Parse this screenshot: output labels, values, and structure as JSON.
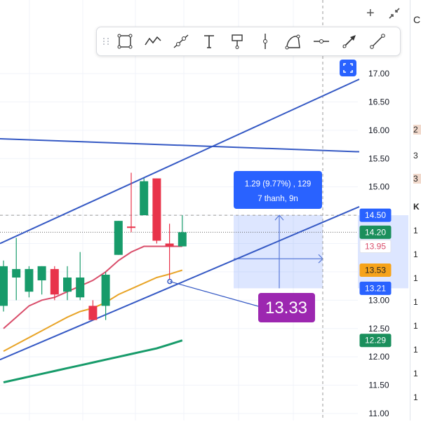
{
  "top_controls": {
    "plus_icon": "+",
    "collapse_icon": "collapse-arrows-icon"
  },
  "toolbar": {
    "tools": [
      {
        "name": "rectangle-tool-icon"
      },
      {
        "name": "path-tool-icon"
      },
      {
        "name": "ray-tool-icon"
      },
      {
        "name": "text-tool-icon",
        "glyph": "T"
      },
      {
        "name": "flag-marker-tool-icon"
      },
      {
        "name": "vertical-line-tool-icon"
      },
      {
        "name": "brush-tool-icon"
      },
      {
        "name": "horizontal-ray-tool-icon"
      },
      {
        "name": "arrow-tool-icon"
      },
      {
        "name": "trend-line-tool-icon"
      }
    ]
  },
  "chart_data": {
    "type": "candlestick",
    "y_axis": {
      "ticks": [
        "17.00",
        "16.50",
        "16.00",
        "15.50",
        "15.00",
        "14.50",
        "14.00",
        "13.50",
        "13.00",
        "12.50",
        "12.00",
        "11.50",
        "11.00"
      ],
      "ylim": [
        11.0,
        17.2
      ]
    },
    "candles": [
      {
        "o": 13.6,
        "h": 13.7,
        "l": 12.8,
        "c": 12.9,
        "color": "green"
      },
      {
        "o": 13.4,
        "h": 14.1,
        "l": 13.0,
        "c": 13.55,
        "color": "green"
      },
      {
        "o": 13.15,
        "h": 13.6,
        "l": 13.05,
        "c": 13.55,
        "color": "green"
      },
      {
        "o": 13.35,
        "h": 13.6,
        "l": 13.1,
        "c": 13.6,
        "color": "green"
      },
      {
        "o": 13.55,
        "h": 13.6,
        "l": 13.0,
        "c": 13.1,
        "color": "red"
      },
      {
        "o": 13.15,
        "h": 13.6,
        "l": 13.0,
        "c": 13.4,
        "color": "green"
      },
      {
        "o": 13.4,
        "h": 13.85,
        "l": 13.0,
        "c": 13.05,
        "color": "green"
      },
      {
        "o": 12.9,
        "h": 13.0,
        "l": 12.65,
        "c": 12.65,
        "color": "red"
      },
      {
        "o": 12.9,
        "h": 13.5,
        "l": 12.65,
        "c": 13.45,
        "color": "green"
      },
      {
        "o": 13.8,
        "h": 14.4,
        "l": 13.8,
        "c": 14.4,
        "color": "green"
      },
      {
        "o": 14.3,
        "h": 15.25,
        "l": 14.2,
        "c": 14.3,
        "color": "red"
      },
      {
        "o": 14.5,
        "h": 15.15,
        "l": 14.5,
        "c": 15.1,
        "color": "green"
      },
      {
        "o": 15.15,
        "h": 15.15,
        "l": 14.0,
        "c": 14.05,
        "color": "red"
      },
      {
        "o": 14.0,
        "h": 14.35,
        "l": 13.33,
        "c": 13.95,
        "color": "red"
      },
      {
        "o": 13.95,
        "h": 14.5,
        "l": 13.95,
        "c": 14.2,
        "color": "green"
      }
    ],
    "series": [
      {
        "name": "",
        "color": "#d94d6a",
        "values": [
          12.5,
          12.7,
          12.9,
          13.0,
          13.05,
          13.15,
          13.25,
          13.35,
          13.5,
          13.7,
          13.85,
          13.95,
          13.95,
          13.95,
          13.95
        ]
      },
      {
        "name": "",
        "color": "#e8a427",
        "values": [
          12.1,
          12.22,
          12.34,
          12.46,
          12.58,
          12.7,
          12.8,
          12.86,
          12.96,
          13.1,
          13.2,
          13.3,
          13.4,
          13.46,
          13.53
        ]
      },
      {
        "name": "",
        "color": "#179b6a",
        "values": [
          11.55,
          11.6,
          11.65,
          11.7,
          11.75,
          11.8,
          11.85,
          11.9,
          11.95,
          12.0,
          12.05,
          12.1,
          12.15,
          12.22,
          12.29
        ]
      }
    ],
    "price_labels": [
      {
        "text": "14.50",
        "value": 14.5,
        "bg": "#2962ff"
      },
      {
        "text": "14.20",
        "value": 14.2,
        "bg": "#1a8f5c"
      },
      {
        "text": "13.95",
        "value": 13.95,
        "bg": "#ffffff",
        "fg": "#d94d6a"
      },
      {
        "text": "13.53",
        "value": 13.53,
        "bg": "#f6a31a",
        "fg": "#222222"
      },
      {
        "text": "13.21",
        "value": 13.21,
        "bg": "#2962ff"
      },
      {
        "text": "12.29",
        "value": 12.29,
        "bg": "#1a8f5c"
      }
    ],
    "measure_box": {
      "label_line1": "1.29 (9.77%) , 129",
      "label_line2": "7 thanh, 9n",
      "top": 14.5,
      "bottom": 13.21
    },
    "callout": {
      "text": "13.33",
      "value": 13.33
    }
  },
  "right_panel": {
    "items": [
      "C",
      "2",
      "3",
      "3",
      "K",
      "1",
      "1",
      "1",
      "1",
      "1",
      "1",
      "1",
      "1",
      "1",
      "1"
    ]
  }
}
